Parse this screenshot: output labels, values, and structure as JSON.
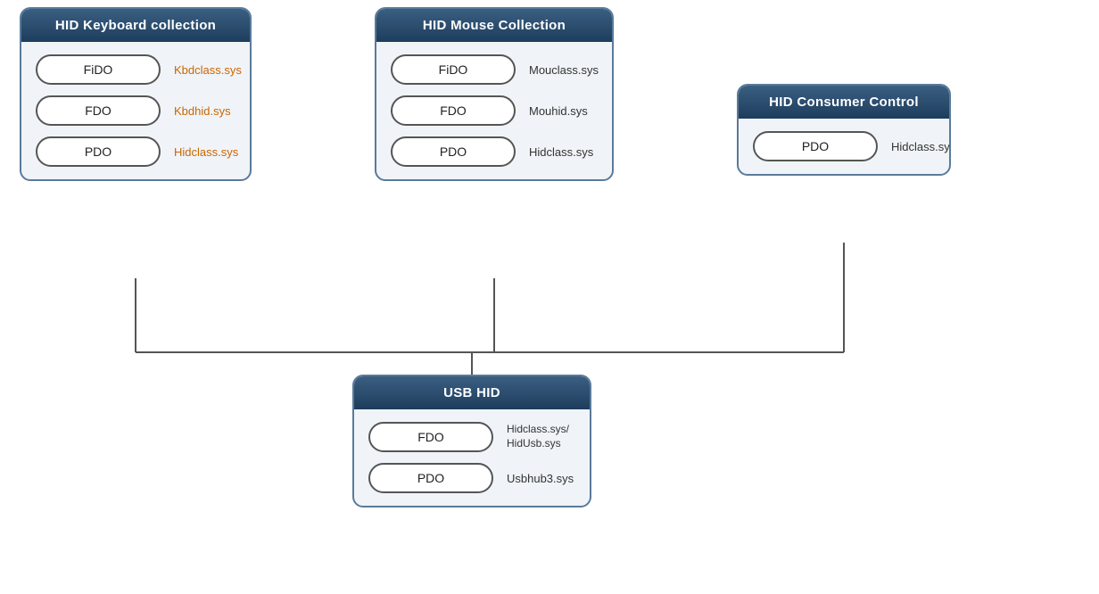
{
  "boxes": {
    "keyboard": {
      "title": "HID Keyboard collection",
      "items": [
        {
          "label": "FiDO",
          "sys": "Kbdclass.sys",
          "sys_color": "orange"
        },
        {
          "label": "FDO",
          "sys": "Kbdhid.sys",
          "sys_color": "orange"
        },
        {
          "label": "PDO",
          "sys": "Hidclass.sys",
          "sys_color": "orange"
        }
      ]
    },
    "mouse": {
      "title": "HID Mouse Collection",
      "items": [
        {
          "label": "FiDO",
          "sys": "Mouclass.sys",
          "sys_color": "black"
        },
        {
          "label": "FDO",
          "sys": "Mouhid.sys",
          "sys_color": "black"
        },
        {
          "label": "PDO",
          "sys": "Hidclass.sys",
          "sys_color": "black"
        }
      ]
    },
    "consumer": {
      "title": "HID Consumer Control",
      "items": [
        {
          "label": "PDO",
          "sys": "Hidclass.sys",
          "sys_color": "black"
        }
      ]
    },
    "usbhid": {
      "title": "USB HID",
      "items": [
        {
          "label": "FDO",
          "sys": "Hidclass.sys/\nHidUsb.sys",
          "sys_color": "black"
        },
        {
          "label": "PDO",
          "sys": "Usbhub3.sys",
          "sys_color": "black"
        }
      ]
    }
  }
}
